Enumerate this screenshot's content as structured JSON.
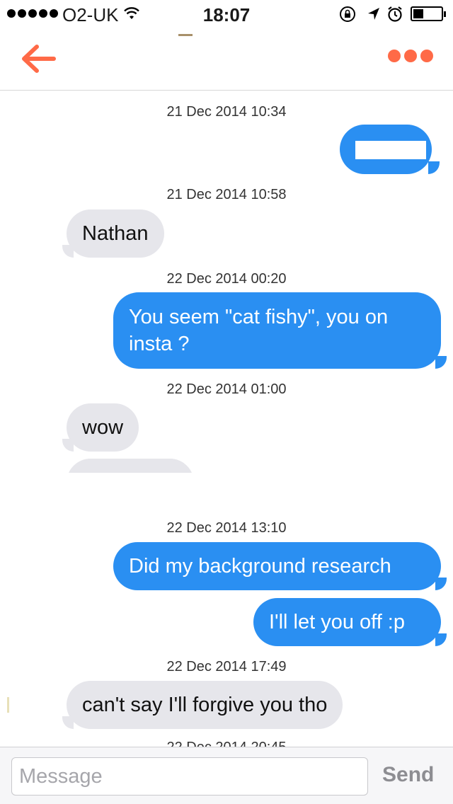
{
  "status_bar": {
    "carrier": "O2-UK",
    "time": "18:07",
    "icons": [
      "signal-dots",
      "wifi-icon",
      "rotation-lock-icon",
      "location-icon",
      "alarm-icon",
      "battery-icon"
    ],
    "battery_level": 0.3
  },
  "nav": {
    "back_icon": "arrow-left-icon",
    "more_icon": "more-dots-icon",
    "accent_color": "#ff6a47"
  },
  "messages": [
    {
      "type": "timestamp",
      "text": "21 Dec 2014 10:34"
    },
    {
      "type": "outgoing",
      "text": "",
      "redacted": true
    },
    {
      "type": "timestamp",
      "text": "21 Dec 2014 10:58"
    },
    {
      "type": "incoming",
      "text": "Nathan"
    },
    {
      "type": "timestamp",
      "text": "22 Dec 2014 00:20"
    },
    {
      "type": "outgoing",
      "text": "You seem \"cat fishy\", you on insta ?"
    },
    {
      "type": "timestamp",
      "text": "22 Dec 2014 01:00"
    },
    {
      "type": "incoming",
      "text": "wow"
    },
    {
      "type": "incoming",
      "text": "",
      "cropped": true
    },
    {
      "type": "timestamp",
      "text": "22 Dec 2014 13:10"
    },
    {
      "type": "outgoing",
      "text": "Did my background research"
    },
    {
      "type": "outgoing",
      "text": "I'll let you off :p"
    },
    {
      "type": "timestamp",
      "text": "22 Dec 2014 17:49"
    },
    {
      "type": "incoming",
      "text": "can't say I'll forgive you tho"
    },
    {
      "type": "timestamp",
      "text": "22 Dec 2014 20:45"
    }
  ],
  "input": {
    "placeholder": "Message",
    "value": "",
    "send_label": "Send"
  },
  "colors": {
    "outgoing_bubble": "#2a8ff2",
    "incoming_bubble": "#e6e6eb"
  }
}
